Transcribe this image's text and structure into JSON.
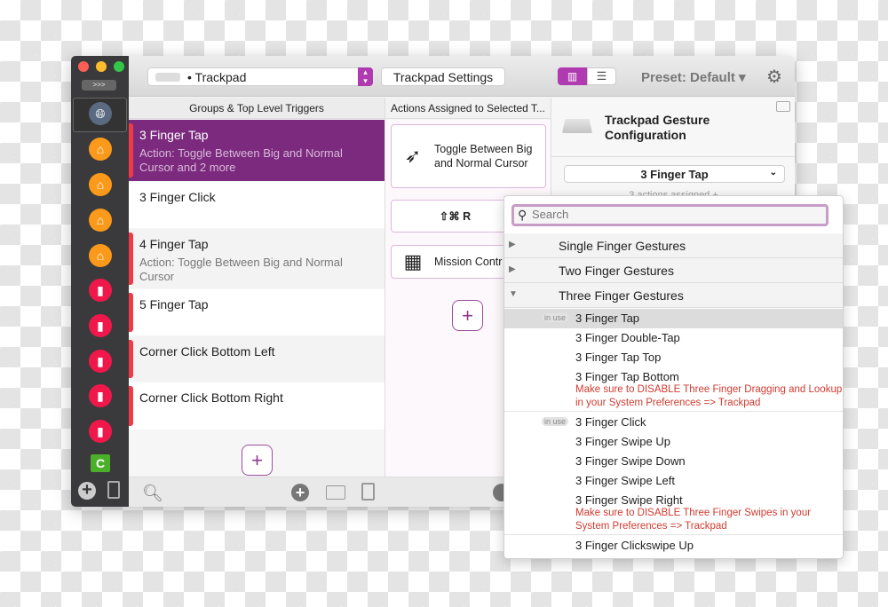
{
  "window": {
    "traffic_lights": [
      "#fc5f57",
      "#fdbc2e",
      "#33c748"
    ]
  },
  "sidebar": {
    "expand_label": ">>>",
    "apps": [
      {
        "icon": "globe-icon",
        "color": "#5a6a80"
      },
      {
        "icon": "home-icon",
        "color": "#fb9a1a"
      },
      {
        "icon": "home-icon",
        "color": "#fb9a1a"
      },
      {
        "icon": "home-icon",
        "color": "#fb9a1a"
      },
      {
        "icon": "home-icon",
        "color": "#fb9a1a"
      },
      {
        "icon": "bars-icon",
        "color": "#f0184a"
      },
      {
        "icon": "bars-icon",
        "color": "#f0184a"
      },
      {
        "icon": "bars-icon",
        "color": "#f0184a"
      },
      {
        "icon": "bars-icon",
        "color": "#f0184a"
      },
      {
        "icon": "bars-icon",
        "color": "#f0184a"
      },
      {
        "icon": "camtasia-icon",
        "color": "#4caf2a"
      }
    ]
  },
  "toolbar": {
    "device_select": "• Trackpad",
    "settings_button": "Trackpad Settings",
    "preset": "Preset: Default ▾",
    "accent": "#b03ab0"
  },
  "groups": {
    "header": "Groups & Top Level Triggers",
    "rows": [
      {
        "title": "3 Finger Tap",
        "sub": "Action: Toggle Between Big and Normal Cursor and 2 more",
        "selected": true
      },
      {
        "title": "3 Finger Click",
        "sub": ""
      },
      {
        "title": "4 Finger Tap",
        "sub": "Action: Toggle Between Big and Normal Cursor"
      },
      {
        "title": "5 Finger Tap",
        "sub": ""
      },
      {
        "title": "Corner Click Bottom Left",
        "sub": ""
      },
      {
        "title": "Corner Click Bottom Right",
        "sub": ""
      }
    ],
    "add": "+"
  },
  "actions": {
    "header": "Actions Assigned to Selected T...",
    "cards": [
      "Toggle Between Big and Normal Cursor",
      "⇧⌘ R",
      "Mission Contr"
    ],
    "add": "+"
  },
  "config": {
    "title": "Trackpad Gesture Configuration",
    "selected_gesture": "3 Finger Tap",
    "assigned": "3 actions assigned +"
  },
  "popup": {
    "search_placeholder": "Search",
    "categories": [
      "Single Finger Gestures",
      "Two Finger Gestures",
      "Three Finger Gestures"
    ],
    "in_use_label": "in use",
    "items": [
      {
        "label": "3 Finger Tap",
        "in_use": true,
        "highlighted": true
      },
      {
        "label": "3 Finger Double-Tap"
      },
      {
        "label": "3 Finger Tap Top"
      },
      {
        "label": "3 Finger Tap Bottom",
        "warning": "Make sure to DISABLE Three Finger Dragging and Lookup in your System Preferences => Trackpad"
      },
      {
        "label": "3 Finger Click",
        "in_use": true
      },
      {
        "label": "3 Finger Swipe Up"
      },
      {
        "label": "3 Finger Swipe Down"
      },
      {
        "label": "3 Finger Swipe Left"
      },
      {
        "label": "3 Finger Swipe Right",
        "warning": "Make sure to DISABLE Three Finger Swipes in your System Preferences => Trackpad"
      },
      {
        "label": "3 Finger Clickswipe Up"
      }
    ]
  }
}
